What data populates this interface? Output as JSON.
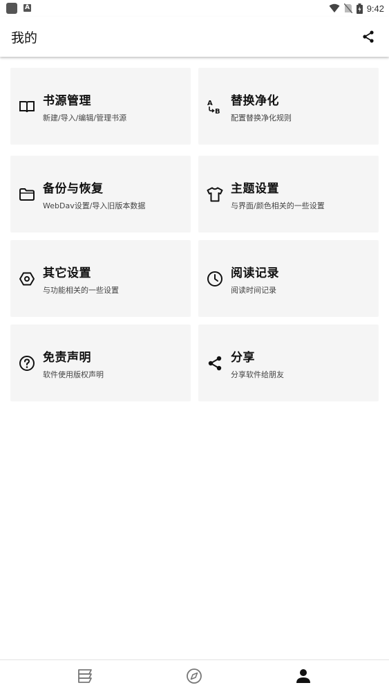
{
  "status_bar": {
    "time": "9:42",
    "icons": [
      "app-icon",
      "a-icon",
      "wifi-icon",
      "no-sim-icon",
      "battery-icon"
    ]
  },
  "app_bar": {
    "title": "我的",
    "share_icon": "share-icon"
  },
  "cards": [
    {
      "title": "书源管理",
      "subtitle": "新建/导入/编辑/管理书源",
      "icon": "book-icon"
    },
    {
      "title": "替换净化",
      "subtitle": "配置替换净化规则",
      "icon": "replace-ab-icon"
    },
    {
      "title": "备份与恢复",
      "subtitle": "WebDav设置/导入旧版本数据",
      "icon": "folder-icon"
    },
    {
      "title": "主题设置",
      "subtitle": "与界面/颜色相关的一些设置",
      "icon": "shirt-icon"
    },
    {
      "title": "其它设置",
      "subtitle": "与功能相关的一些设置",
      "icon": "settings-hex-icon"
    },
    {
      "title": "阅读记录",
      "subtitle": "阅读时间记录",
      "icon": "clock-icon"
    },
    {
      "title": "免责声明",
      "subtitle": "软件使用版权声明",
      "icon": "help-circle-icon"
    },
    {
      "title": "分享",
      "subtitle": "分享软件给朋友",
      "icon": "share-icon"
    }
  ],
  "bottom_nav": {
    "items": [
      {
        "icon": "bookshelf-icon",
        "active": false
      },
      {
        "icon": "compass-icon",
        "active": false
      },
      {
        "icon": "person-icon",
        "active": true
      }
    ]
  },
  "colors": {
    "card_bg": "#f5f5f5",
    "icon": "#111111",
    "inactive_nav": "#777777"
  }
}
